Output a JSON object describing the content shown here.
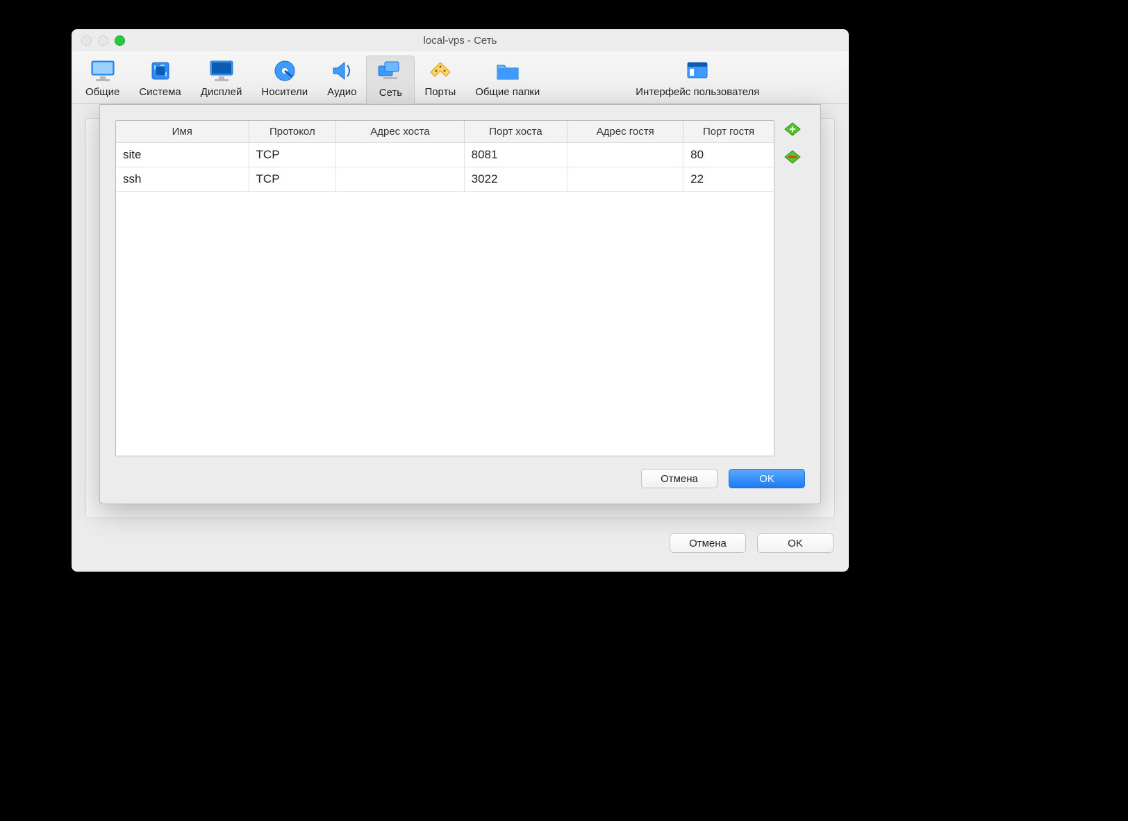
{
  "window": {
    "title": "local-vps - Сеть"
  },
  "toolbar": {
    "items": [
      {
        "label": "Общие"
      },
      {
        "label": "Система"
      },
      {
        "label": "Дисплей"
      },
      {
        "label": "Носители"
      },
      {
        "label": "Аудио"
      },
      {
        "label": "Сеть"
      },
      {
        "label": "Порты"
      },
      {
        "label": "Общие папки"
      },
      {
        "label": "Интерфейс пользователя"
      }
    ]
  },
  "table": {
    "headers": {
      "name": "Имя",
      "protocol": "Протокол",
      "host_addr": "Адрес хоста",
      "host_port": "Порт хоста",
      "guest_addr": "Адрес гостя",
      "guest_port": "Порт гостя"
    },
    "rows": [
      {
        "name": "site",
        "protocol": "TCP",
        "host_addr": "",
        "host_port": "8081",
        "guest_addr": "",
        "guest_port": "80"
      },
      {
        "name": "ssh",
        "protocol": "TCP",
        "host_addr": "",
        "host_port": "3022",
        "guest_addr": "",
        "guest_port": "22"
      }
    ]
  },
  "modal": {
    "cancel": "Отмена",
    "ok": "OK"
  },
  "footer": {
    "cancel": "Отмена",
    "ok": "OK"
  }
}
